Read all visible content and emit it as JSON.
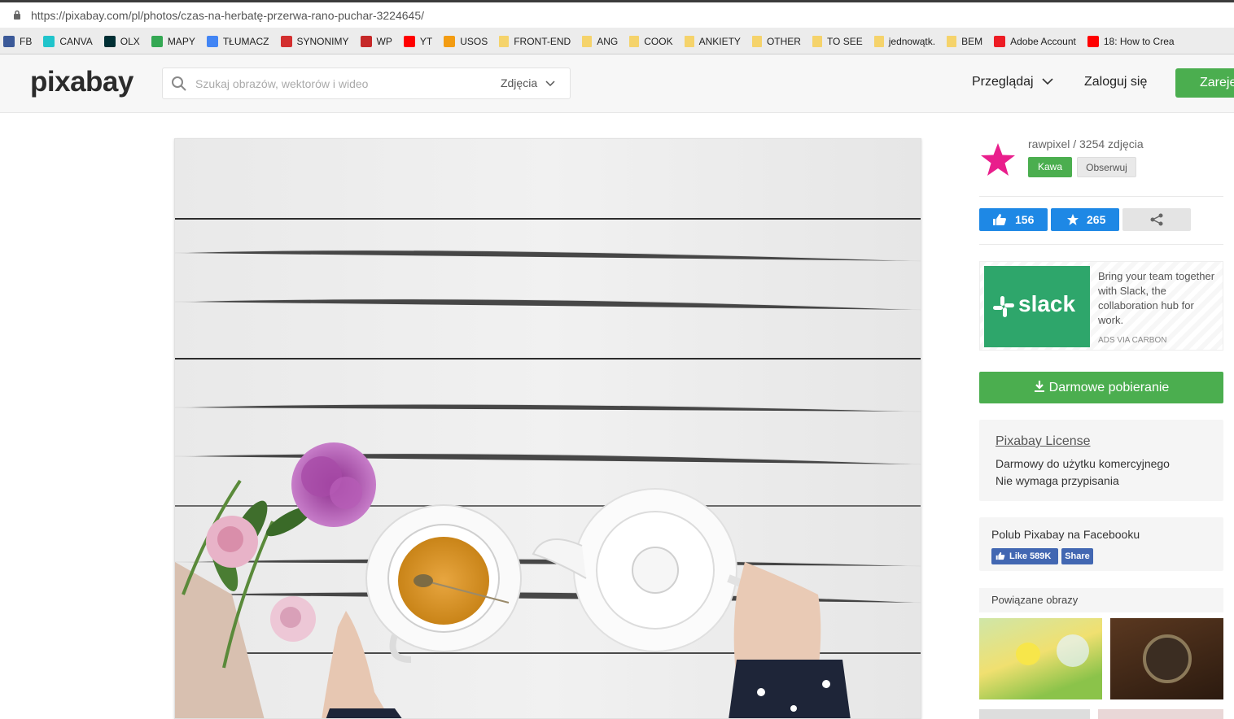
{
  "browser": {
    "url": "https://pixabay.com/pl/photos/czas-na-herbatę-przerwa-rano-puchar-3224645/",
    "bookmarks": [
      {
        "label": "FB",
        "icon": "facebook-icon",
        "color": "#3b5998"
      },
      {
        "label": "CANVA",
        "icon": "canva-icon",
        "color": "#20c4cb"
      },
      {
        "label": "OLX",
        "icon": "olx-icon",
        "color": "#002f34"
      },
      {
        "label": "MAPY",
        "icon": "maps-icon",
        "color": "#34a853"
      },
      {
        "label": "TŁUMACZ",
        "icon": "translate-icon",
        "color": "#4285f4"
      },
      {
        "label": "SYNONIMY",
        "icon": "synonimy-icon",
        "color": "#d32f2f"
      },
      {
        "label": "WP",
        "icon": "wp-icon",
        "color": "#c62828"
      },
      {
        "label": "YT",
        "icon": "youtube-icon",
        "color": "#ff0000"
      },
      {
        "label": "USOS",
        "icon": "usos-icon",
        "color": "#f39c12"
      },
      {
        "label": "FRONT-END",
        "icon": "folder-icon",
        "color": "#f5d36b"
      },
      {
        "label": "ANG",
        "icon": "folder-icon",
        "color": "#f5d36b"
      },
      {
        "label": "COOK",
        "icon": "folder-icon",
        "color": "#f5d36b"
      },
      {
        "label": "ANKIETY",
        "icon": "folder-icon",
        "color": "#f5d36b"
      },
      {
        "label": "OTHER",
        "icon": "folder-icon",
        "color": "#f5d36b"
      },
      {
        "label": "TO SEE",
        "icon": "folder-icon",
        "color": "#f5d36b"
      },
      {
        "label": "jednowątk.",
        "icon": "folder-icon",
        "color": "#f5d36b"
      },
      {
        "label": "BEM",
        "icon": "folder-icon",
        "color": "#f5d36b"
      },
      {
        "label": "Adobe Account",
        "icon": "adobe-icon",
        "color": "#ed1c24"
      },
      {
        "label": "18: How to Crea",
        "icon": "youtube-icon",
        "color": "#ff0000"
      }
    ]
  },
  "header": {
    "logo": "pixabay",
    "search_placeholder": "Szukaj obrazów, wektorów i wideo",
    "search_category": "Zdjęcia",
    "browse": "Przeglądaj",
    "login": "Zaloguj się",
    "register": "Zareje"
  },
  "sidebar": {
    "author": "rawpixel / 3254 zdjęcia",
    "coffee": "Kawa",
    "follow": "Obserwuj",
    "likes": "156",
    "favorites": "265",
    "ad": {
      "brand": "slack",
      "text": "Bring your team together with Slack, the collaboration hub for work.",
      "via": "ADS VIA CARBON"
    },
    "download": "Darmowe pobieranie",
    "license": {
      "title": "Pixabay License",
      "line1": "Darmowy do użytku komercyjnego",
      "line2": "Nie wymaga przypisania"
    },
    "facebook": {
      "title": "Polub Pixabay na Facebooku",
      "like": "Like 589K",
      "share": "Share"
    },
    "related": "Powiązane obrazy"
  },
  "colors": {
    "accent_green": "#4bae4f",
    "like_blue": "#1e88e5",
    "author_star": "#e91e8c",
    "slack_green": "#2ea66b",
    "facebook_blue": "#4267b2"
  }
}
